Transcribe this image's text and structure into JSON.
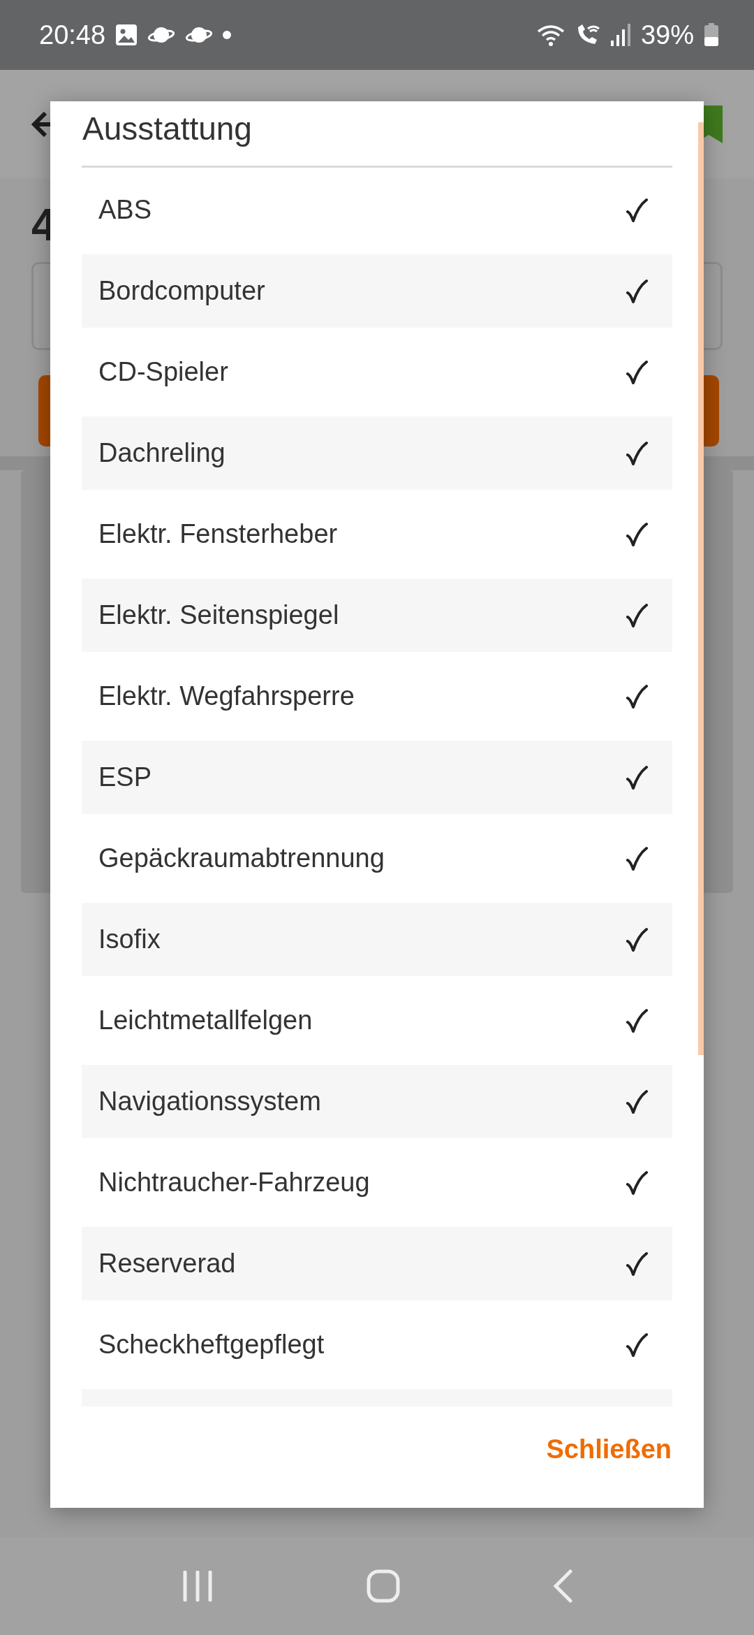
{
  "status_bar": {
    "time": "20:48",
    "battery": "39%"
  },
  "background": {
    "heading": "4"
  },
  "dialog": {
    "title": "Ausstattung",
    "items": [
      {
        "label": "ABS",
        "checked": true
      },
      {
        "label": "Bordcomputer",
        "checked": true
      },
      {
        "label": "CD-Spieler",
        "checked": true
      },
      {
        "label": "Dachreling",
        "checked": true
      },
      {
        "label": "Elektr. Fensterheber",
        "checked": true
      },
      {
        "label": "Elektr. Seitenspiegel",
        "checked": true
      },
      {
        "label": "Elektr. Wegfahrsperre",
        "checked": true
      },
      {
        "label": "ESP",
        "checked": true
      },
      {
        "label": "Gepäckraumabtrennung",
        "checked": true
      },
      {
        "label": "Isofix",
        "checked": true
      },
      {
        "label": "Leichtmetallfelgen",
        "checked": true
      },
      {
        "label": "Navigationssystem",
        "checked": true
      },
      {
        "label": "Nichtraucher-Fahrzeug",
        "checked": true
      },
      {
        "label": "Reserverad",
        "checked": true
      },
      {
        "label": "Scheckheftgepflegt",
        "checked": true
      }
    ],
    "close_button": "Schließen"
  }
}
